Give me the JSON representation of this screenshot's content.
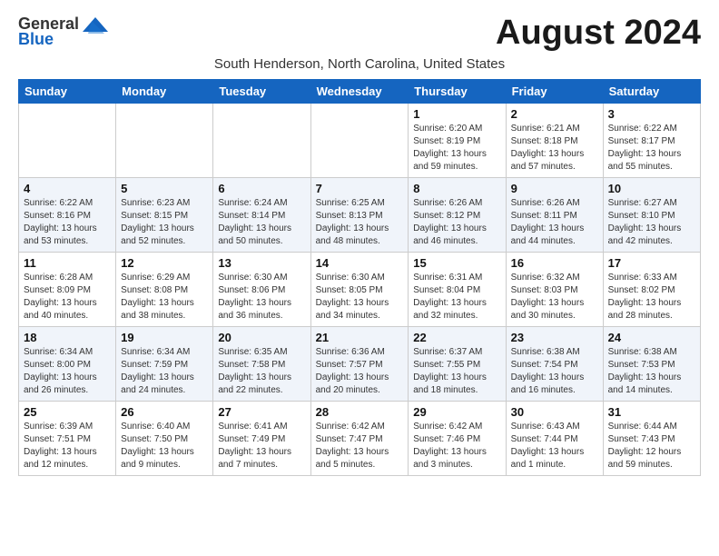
{
  "header": {
    "logo_general": "General",
    "logo_blue": "Blue",
    "month_title": "August 2024",
    "location": "South Henderson, North Carolina, United States"
  },
  "weekdays": [
    "Sunday",
    "Monday",
    "Tuesday",
    "Wednesday",
    "Thursday",
    "Friday",
    "Saturday"
  ],
  "weeks": [
    [
      {
        "day": "",
        "info": ""
      },
      {
        "day": "",
        "info": ""
      },
      {
        "day": "",
        "info": ""
      },
      {
        "day": "",
        "info": ""
      },
      {
        "day": "1",
        "info": "Sunrise: 6:20 AM\nSunset: 8:19 PM\nDaylight: 13 hours\nand 59 minutes."
      },
      {
        "day": "2",
        "info": "Sunrise: 6:21 AM\nSunset: 8:18 PM\nDaylight: 13 hours\nand 57 minutes."
      },
      {
        "day": "3",
        "info": "Sunrise: 6:22 AM\nSunset: 8:17 PM\nDaylight: 13 hours\nand 55 minutes."
      }
    ],
    [
      {
        "day": "4",
        "info": "Sunrise: 6:22 AM\nSunset: 8:16 PM\nDaylight: 13 hours\nand 53 minutes."
      },
      {
        "day": "5",
        "info": "Sunrise: 6:23 AM\nSunset: 8:15 PM\nDaylight: 13 hours\nand 52 minutes."
      },
      {
        "day": "6",
        "info": "Sunrise: 6:24 AM\nSunset: 8:14 PM\nDaylight: 13 hours\nand 50 minutes."
      },
      {
        "day": "7",
        "info": "Sunrise: 6:25 AM\nSunset: 8:13 PM\nDaylight: 13 hours\nand 48 minutes."
      },
      {
        "day": "8",
        "info": "Sunrise: 6:26 AM\nSunset: 8:12 PM\nDaylight: 13 hours\nand 46 minutes."
      },
      {
        "day": "9",
        "info": "Sunrise: 6:26 AM\nSunset: 8:11 PM\nDaylight: 13 hours\nand 44 minutes."
      },
      {
        "day": "10",
        "info": "Sunrise: 6:27 AM\nSunset: 8:10 PM\nDaylight: 13 hours\nand 42 minutes."
      }
    ],
    [
      {
        "day": "11",
        "info": "Sunrise: 6:28 AM\nSunset: 8:09 PM\nDaylight: 13 hours\nand 40 minutes."
      },
      {
        "day": "12",
        "info": "Sunrise: 6:29 AM\nSunset: 8:08 PM\nDaylight: 13 hours\nand 38 minutes."
      },
      {
        "day": "13",
        "info": "Sunrise: 6:30 AM\nSunset: 8:06 PM\nDaylight: 13 hours\nand 36 minutes."
      },
      {
        "day": "14",
        "info": "Sunrise: 6:30 AM\nSunset: 8:05 PM\nDaylight: 13 hours\nand 34 minutes."
      },
      {
        "day": "15",
        "info": "Sunrise: 6:31 AM\nSunset: 8:04 PM\nDaylight: 13 hours\nand 32 minutes."
      },
      {
        "day": "16",
        "info": "Sunrise: 6:32 AM\nSunset: 8:03 PM\nDaylight: 13 hours\nand 30 minutes."
      },
      {
        "day": "17",
        "info": "Sunrise: 6:33 AM\nSunset: 8:02 PM\nDaylight: 13 hours\nand 28 minutes."
      }
    ],
    [
      {
        "day": "18",
        "info": "Sunrise: 6:34 AM\nSunset: 8:00 PM\nDaylight: 13 hours\nand 26 minutes."
      },
      {
        "day": "19",
        "info": "Sunrise: 6:34 AM\nSunset: 7:59 PM\nDaylight: 13 hours\nand 24 minutes."
      },
      {
        "day": "20",
        "info": "Sunrise: 6:35 AM\nSunset: 7:58 PM\nDaylight: 13 hours\nand 22 minutes."
      },
      {
        "day": "21",
        "info": "Sunrise: 6:36 AM\nSunset: 7:57 PM\nDaylight: 13 hours\nand 20 minutes."
      },
      {
        "day": "22",
        "info": "Sunrise: 6:37 AM\nSunset: 7:55 PM\nDaylight: 13 hours\nand 18 minutes."
      },
      {
        "day": "23",
        "info": "Sunrise: 6:38 AM\nSunset: 7:54 PM\nDaylight: 13 hours\nand 16 minutes."
      },
      {
        "day": "24",
        "info": "Sunrise: 6:38 AM\nSunset: 7:53 PM\nDaylight: 13 hours\nand 14 minutes."
      }
    ],
    [
      {
        "day": "25",
        "info": "Sunrise: 6:39 AM\nSunset: 7:51 PM\nDaylight: 13 hours\nand 12 minutes."
      },
      {
        "day": "26",
        "info": "Sunrise: 6:40 AM\nSunset: 7:50 PM\nDaylight: 13 hours\nand 9 minutes."
      },
      {
        "day": "27",
        "info": "Sunrise: 6:41 AM\nSunset: 7:49 PM\nDaylight: 13 hours\nand 7 minutes."
      },
      {
        "day": "28",
        "info": "Sunrise: 6:42 AM\nSunset: 7:47 PM\nDaylight: 13 hours\nand 5 minutes."
      },
      {
        "day": "29",
        "info": "Sunrise: 6:42 AM\nSunset: 7:46 PM\nDaylight: 13 hours\nand 3 minutes."
      },
      {
        "day": "30",
        "info": "Sunrise: 6:43 AM\nSunset: 7:44 PM\nDaylight: 13 hours\nand 1 minute."
      },
      {
        "day": "31",
        "info": "Sunrise: 6:44 AM\nSunset: 7:43 PM\nDaylight: 12 hours\nand 59 minutes."
      }
    ]
  ]
}
